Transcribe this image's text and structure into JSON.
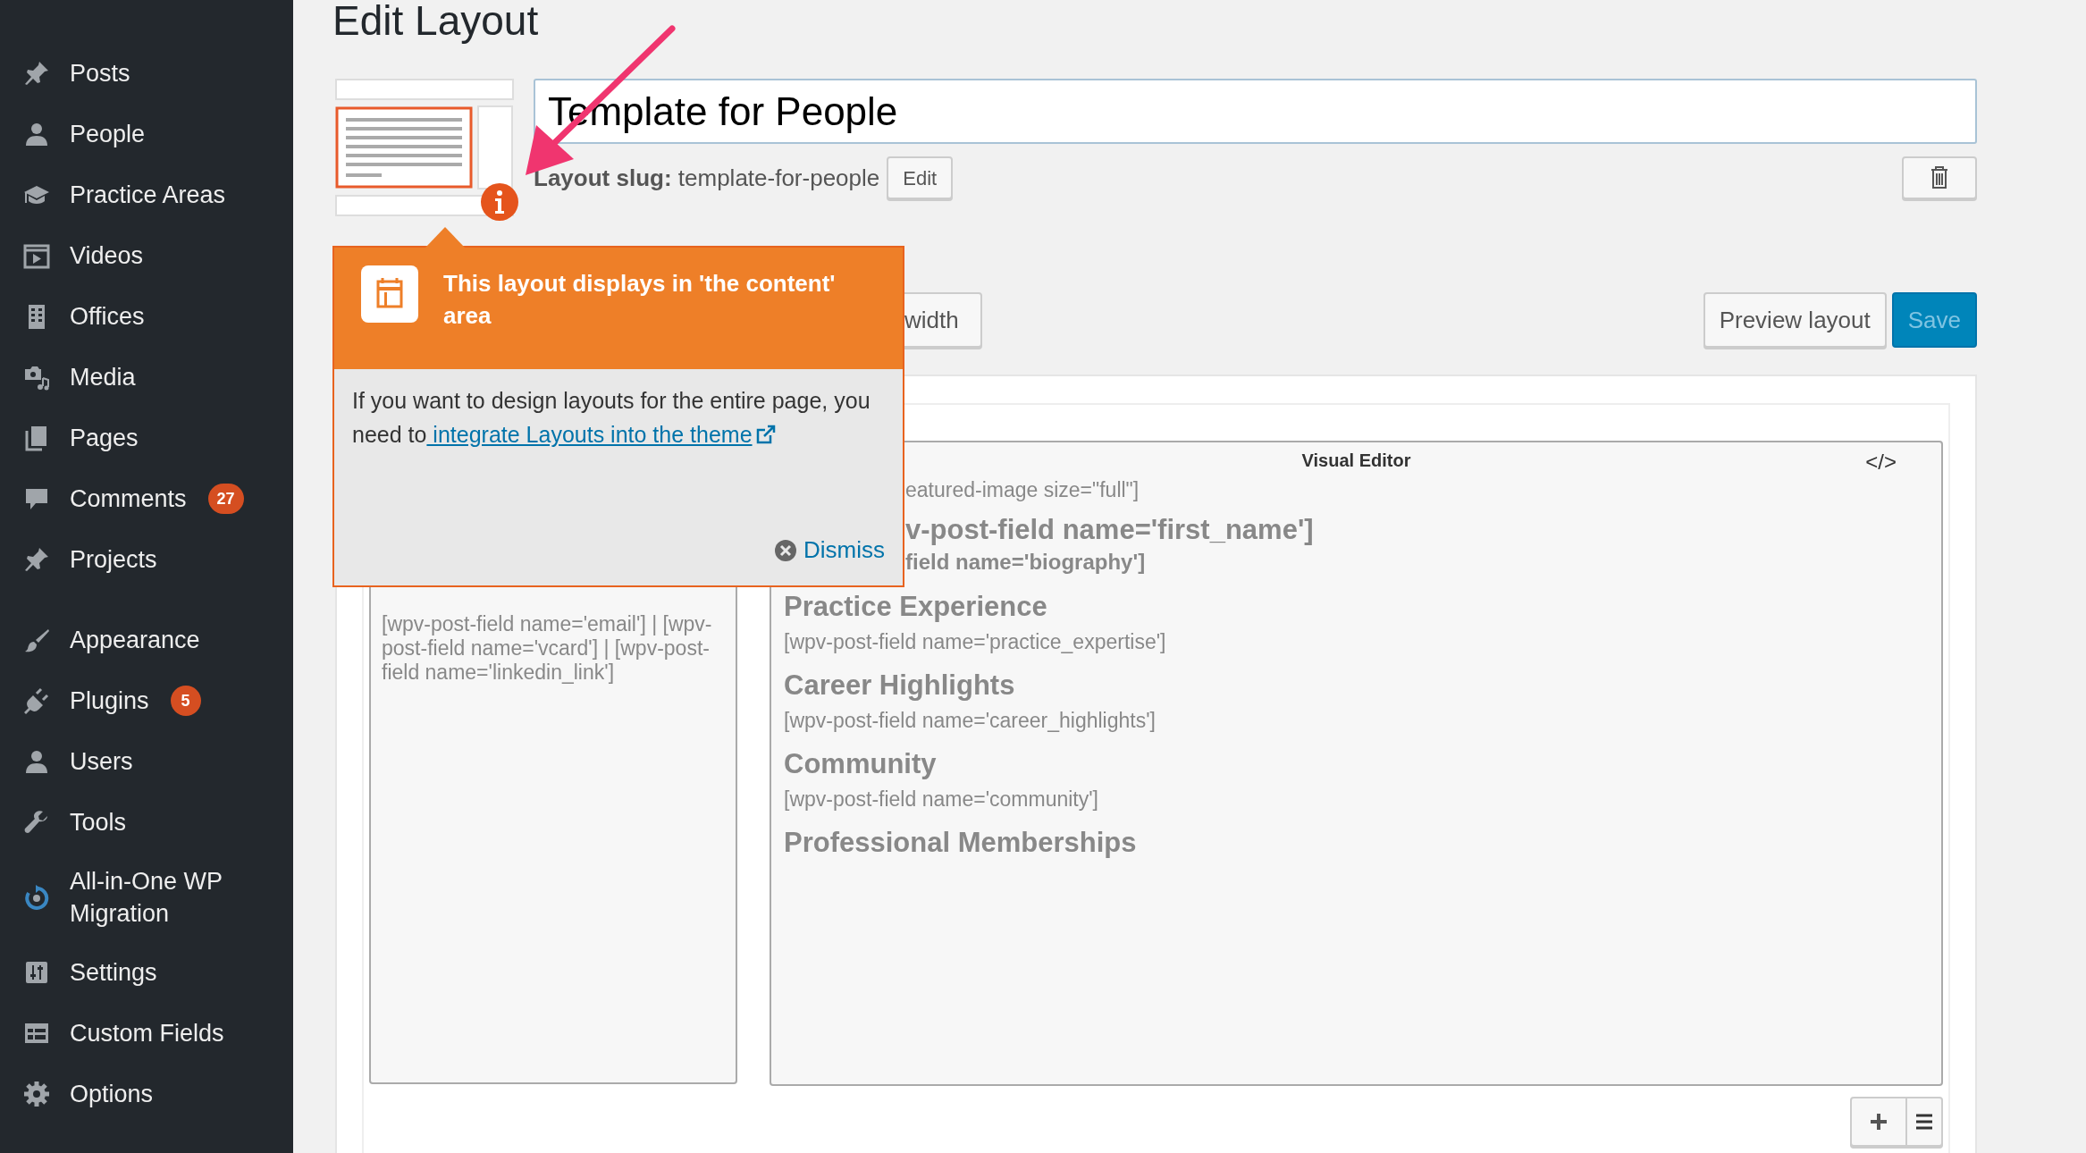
{
  "sidebar": {
    "groups": [
      [
        {
          "label": "Posts"
        },
        {
          "label": "People"
        },
        {
          "label": "Practice Areas"
        },
        {
          "label": "Videos"
        },
        {
          "label": "Offices"
        },
        {
          "label": "Media"
        },
        {
          "label": "Pages"
        },
        {
          "label": "Comments",
          "count": "27"
        },
        {
          "label": "Projects"
        }
      ],
      [
        {
          "label": "Appearance"
        },
        {
          "label": "Plugins",
          "count": "5"
        },
        {
          "label": "Users"
        },
        {
          "label": "Tools"
        },
        {
          "label": "All-in-One WP Migration"
        },
        {
          "label": "Settings"
        },
        {
          "label": "Custom Fields"
        },
        {
          "label": "Options"
        }
      ]
    ]
  },
  "page": {
    "title": "Edit Layout"
  },
  "layout": {
    "name": "Template for People",
    "slug_label": "Layout slug:",
    "slug": "template-for-people",
    "edit_button": "Edit"
  },
  "toolbar": {
    "width_button": "width",
    "preview_button": "Preview layout",
    "save_button": "Save"
  },
  "editor": {
    "left_cell": "[wpv-post-field name='email'] | [wpv-post-field name='vcard'] | [wpv-post-field name='linkedin_link']",
    "visual_editor": {
      "title": "Visual Editor",
      "code_toggle": "</>",
      "content": [
        {
          "kind": "code",
          "text": "eatured-image size=\"full\"]",
          "cut": true
        },
        {
          "kind": "title",
          "text": "v-post-field name='first_name']",
          "cut": true
        },
        {
          "kind": "strong",
          "text": "field name='biography']",
          "cut": true
        },
        {
          "kind": "heading",
          "text": "Practice Experience"
        },
        {
          "kind": "code",
          "text": "[wpv-post-field name='practice_expertise']"
        },
        {
          "kind": "heading",
          "text": "Career Highlights"
        },
        {
          "kind": "code",
          "text": "[wpv-post-field name='career_highlights']"
        },
        {
          "kind": "heading",
          "text": "Community"
        },
        {
          "kind": "code",
          "text": "[wpv-post-field name='community']"
        },
        {
          "kind": "heading",
          "text": "Professional Memberships"
        }
      ]
    }
  },
  "popover": {
    "title": "This layout displays in 'the content' area",
    "body": "If you want to design layouts for the entire page, you need to",
    "link": " integrate Layouts into the theme",
    "dismiss": "Dismiss"
  }
}
